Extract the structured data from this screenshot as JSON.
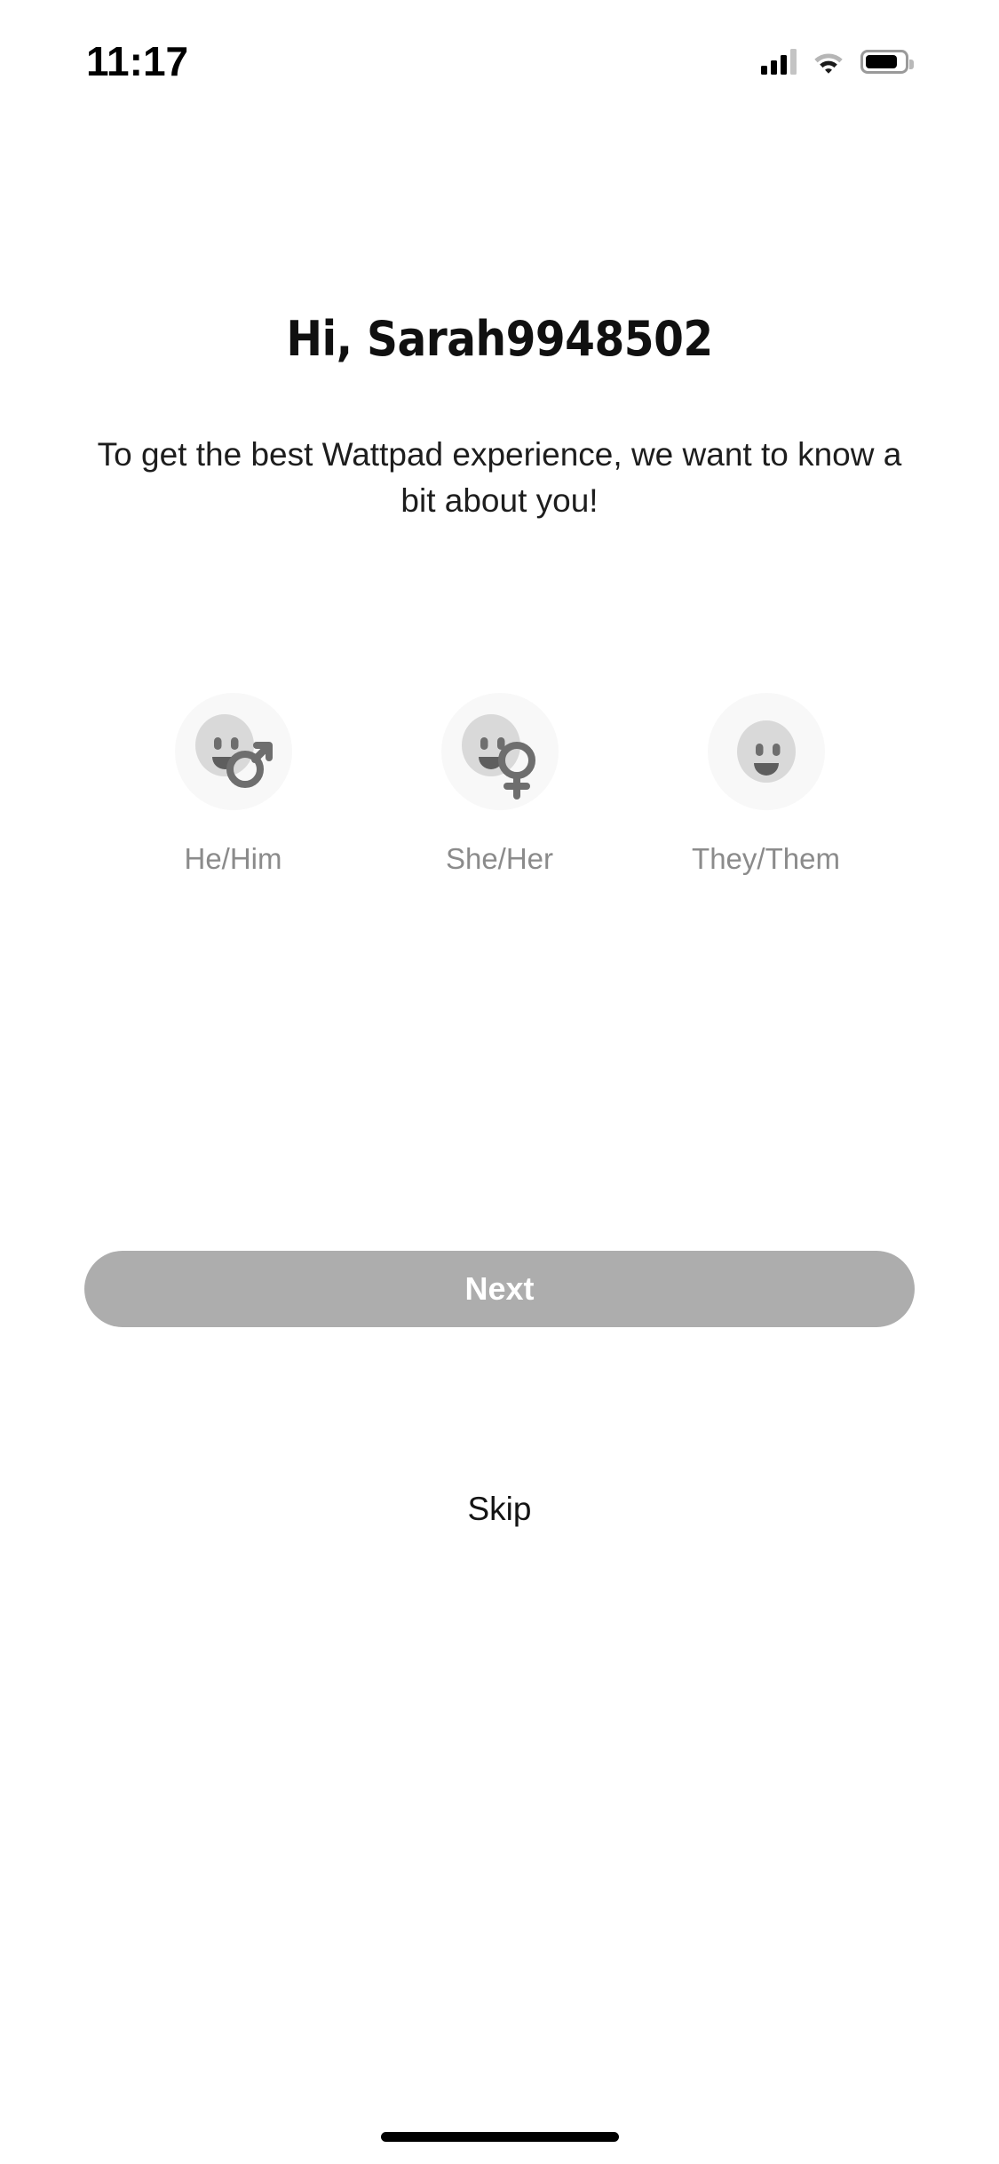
{
  "status_bar": {
    "time": "11:17",
    "cellular_icon": "cellular-signal-icon",
    "wifi_icon": "wifi-icon",
    "battery_icon": "battery-icon"
  },
  "header": {
    "title": "Hi, Sarah9948502",
    "subtitle": "To get the best Wattpad experience, we want to know a bit about you!"
  },
  "pronouns": {
    "options": [
      {
        "label": "He/Him",
        "icon": "face-with-male-symbol-icon",
        "symbol": "male"
      },
      {
        "label": "She/Her",
        "icon": "face-with-female-symbol-icon",
        "symbol": "female"
      },
      {
        "label": "They/Them",
        "icon": "face-neutral-icon",
        "symbol": "none"
      }
    ]
  },
  "actions": {
    "next_label": "Next",
    "skip_label": "Skip"
  },
  "colors": {
    "background": "#ffffff",
    "title": "#101010",
    "subtitle": "#1d1d1d",
    "option_label": "#8b8b8b",
    "avatar_background": "#f8f8f8",
    "face_fill": "#d9d9d9",
    "face_feature": "#6e6e6e",
    "symbol": "#6e6e6e",
    "next_button_background": "#adadad",
    "next_button_text": "#ffffff",
    "skip_text": "#141414",
    "home_indicator": "#000000"
  }
}
